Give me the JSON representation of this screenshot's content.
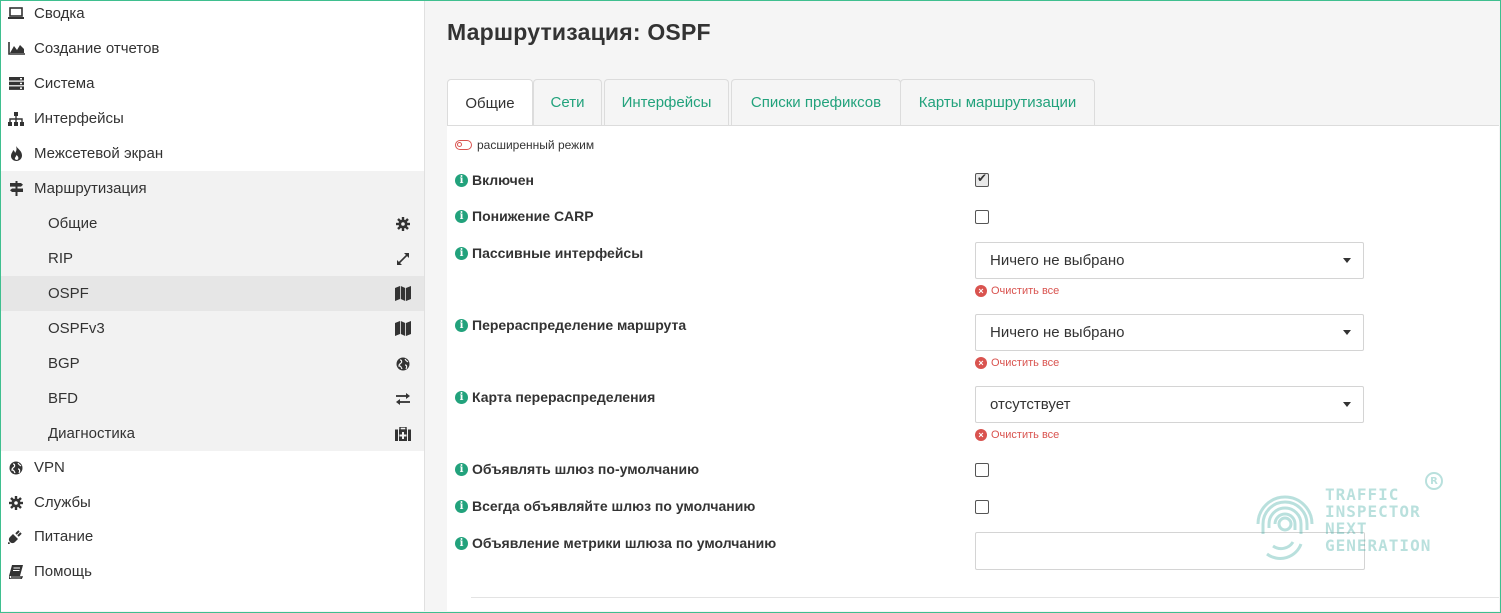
{
  "sidebar": {
    "items": [
      {
        "label": "Сводка",
        "icon": "laptop-icon"
      },
      {
        "label": "Создание отчетов",
        "icon": "area-chart-icon"
      },
      {
        "label": "Система",
        "icon": "server-icon"
      },
      {
        "label": "Интерфейсы",
        "icon": "sitemap-icon"
      },
      {
        "label": "Межсетевой экран",
        "icon": "fire-icon"
      },
      {
        "label": "Маршрутизация",
        "icon": "signpost-icon"
      },
      {
        "label": "VPN",
        "icon": "globe-icon"
      },
      {
        "label": "Службы",
        "icon": "gear-icon"
      },
      {
        "label": "Питание",
        "icon": "plug-icon"
      },
      {
        "label": "Помощь",
        "icon": "book-icon"
      }
    ],
    "routing_sub": [
      {
        "label": "Общие",
        "icon": "gear-icon"
      },
      {
        "label": "RIP",
        "icon": "expand-icon"
      },
      {
        "label": "OSPF",
        "icon": "map-icon"
      },
      {
        "label": "OSPFv3",
        "icon": "map-icon"
      },
      {
        "label": "BGP",
        "icon": "globe-icon"
      },
      {
        "label": "BFD",
        "icon": "exchange-icon"
      },
      {
        "label": "Диагностика",
        "icon": "medkit-icon"
      }
    ]
  },
  "main": {
    "title": "Маршрутизация: OSPF",
    "tabs": [
      {
        "label": "Общие"
      },
      {
        "label": "Сети"
      },
      {
        "label": "Интерфейсы"
      },
      {
        "label": "Списки префиксов"
      },
      {
        "label": "Карты маршрутизации"
      }
    ],
    "advanced_mode": "расширенный режим",
    "fields": {
      "enabled": {
        "label": "Включен",
        "checked": true
      },
      "carp": {
        "label": "Понижение CARP",
        "checked": false
      },
      "passive": {
        "label": "Пассивные интерфейсы",
        "value": "Ничего не выбрано",
        "clear": "Очистить все"
      },
      "redistribution": {
        "label": "Перераспределение маршрута",
        "value": "Ничего не выбрано",
        "clear": "Очистить все"
      },
      "redist_map": {
        "label": "Карта перераспределения",
        "value": "отсутствует",
        "clear": "Очистить все"
      },
      "default_gw": {
        "label": "Объявлять шлюз по-умолчанию",
        "checked": false
      },
      "always_gw": {
        "label": "Всегда объявляйте шлюз по умолчанию",
        "checked": false
      },
      "gw_metric": {
        "label": "Объявление метрики шлюза по умолчанию",
        "value": ""
      }
    }
  },
  "watermark": {
    "lines": [
      "TRAFFIC",
      "INSPECTOR",
      "NEXT",
      "GENERATION"
    ],
    "mark": "R",
    "color": "#3aa9a0"
  },
  "colors": {
    "accent": "#22a27c",
    "danger": "#d9534f"
  }
}
